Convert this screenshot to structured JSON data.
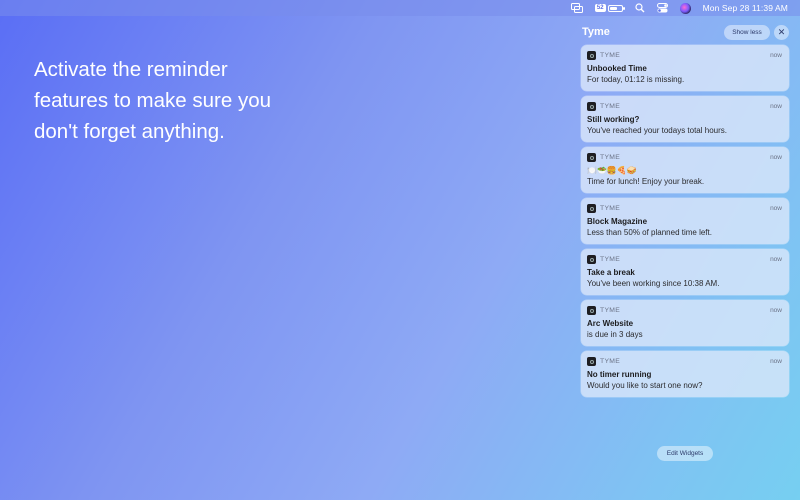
{
  "menubar": {
    "battery_badge": "52",
    "date_time": "Mon Sep 28  11:39 AM"
  },
  "headline": {
    "lines": [
      "Activate the reminder",
      "features to make sure you",
      "don't forget anything."
    ]
  },
  "notification_center": {
    "title": "Tyme",
    "show_less_label": "Show less",
    "close_label": "✕",
    "edit_widgets_label": "Edit Widgets",
    "notifications": [
      {
        "app": "TYME",
        "time": "now",
        "title": "Unbooked Time",
        "body": "For today, 01:12 is missing."
      },
      {
        "app": "TYME",
        "time": "now",
        "title": "Still working?",
        "body": "You've reached your todays total hours."
      },
      {
        "app": "TYME",
        "time": "now",
        "title": "🍽️🥗🍔🍕🥪",
        "body": "Time for lunch! Enjoy your break."
      },
      {
        "app": "TYME",
        "time": "now",
        "title": "Block Magazine",
        "body": "Less than 50% of planned time left."
      },
      {
        "app": "TYME",
        "time": "now",
        "title": "Take a break",
        "body": "You've been working since 10:38 AM."
      },
      {
        "app": "TYME",
        "time": "now",
        "title": "Arc Website",
        "body": "is due in 3 days"
      },
      {
        "app": "TYME",
        "time": "now",
        "title": "No timer running",
        "body": "Would you like to start one now?"
      }
    ]
  },
  "colors": {
    "accent": "#5a6ef5",
    "card_bg": "#dce8fa"
  }
}
